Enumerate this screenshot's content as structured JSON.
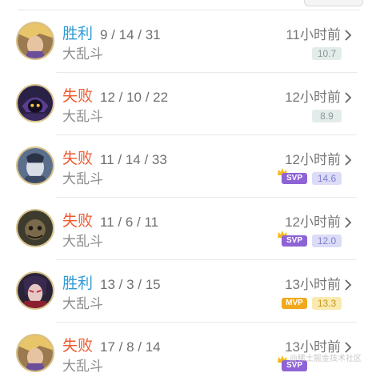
{
  "colors": {
    "win": "#2e9bd6",
    "loss": "#ef5a30",
    "score_plain_bg": "#e3ecea",
    "score_plain_fg": "#8a9a95",
    "score_svp_bg": "#dcdcf7",
    "score_svp_fg": "#7f80d2",
    "score_mvp_bg": "#faeab0",
    "score_mvp_fg": "#c7961d",
    "svp_badge": "#8e63d6",
    "mvp_badge": "#f0a81c"
  },
  "matches": [
    {
      "result": "胜利",
      "outcome": "win",
      "kda": "9 / 14 / 31",
      "mode": "大乱斗",
      "time": "11小时前",
      "score": "10.7",
      "badge": "",
      "avatar_icon": "hero-avatar-icon"
    },
    {
      "result": "失败",
      "outcome": "loss",
      "kda": "12 / 10 / 22",
      "mode": "大乱斗",
      "time": "12小时前",
      "score": "8.9",
      "badge": "",
      "avatar_icon": "hero-avatar-icon"
    },
    {
      "result": "失败",
      "outcome": "loss",
      "kda": "11 / 14 / 33",
      "mode": "大乱斗",
      "time": "12小时前",
      "score": "14.6",
      "badge": "SVP",
      "avatar_icon": "hero-avatar-icon"
    },
    {
      "result": "失败",
      "outcome": "loss",
      "kda": "11 / 6 / 11",
      "mode": "大乱斗",
      "time": "12小时前",
      "score": "12.0",
      "badge": "SVP",
      "avatar_icon": "hero-avatar-icon"
    },
    {
      "result": "胜利",
      "outcome": "win",
      "kda": "13 / 3 / 15",
      "mode": "大乱斗",
      "time": "13小时前",
      "score": "13.3",
      "badge": "MVP",
      "avatar_icon": "hero-avatar-icon"
    },
    {
      "result": "失败",
      "outcome": "loss",
      "kda": "17 / 8 / 14",
      "mode": "大乱斗",
      "time": "13小时前",
      "score": "",
      "badge": "SVP",
      "avatar_icon": "hero-avatar-icon"
    }
  ],
  "watermark": "@稀土掘金技术社区"
}
